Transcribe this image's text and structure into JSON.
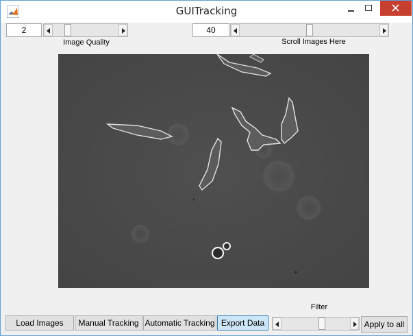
{
  "window": {
    "title": "GUITracking",
    "icon": "matlab-icon"
  },
  "controls": {
    "quality_value": "2",
    "quality_label": "Image Quality",
    "quality_slider_fraction": 0.2,
    "scroll_value": "40",
    "scroll_label": "Scroll Images Here",
    "scroll_slider_fraction": 0.5
  },
  "image": {
    "description_icon": "phase-contrast-cells-image"
  },
  "bottom": {
    "load_label": "Load Images",
    "manual_label": "Manual Tracking",
    "auto_label": "Automatic Tracking",
    "export_label": "Export Data",
    "filter_label": "Filter",
    "filter_slider_fraction": 0.6,
    "apply_label": "Apply to all"
  },
  "colors": {
    "accent_selected": "#cde6f7",
    "close_button": "#c7402f"
  }
}
